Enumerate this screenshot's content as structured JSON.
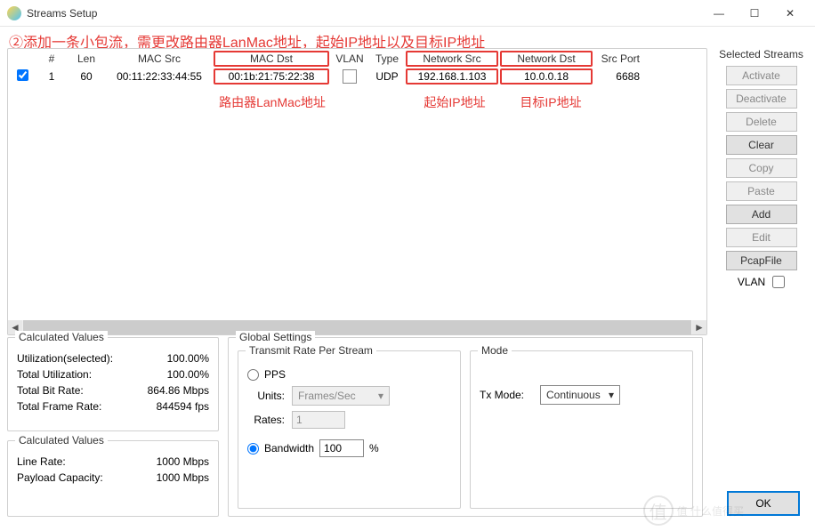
{
  "window": {
    "title": "Streams Setup",
    "minimize": "—",
    "maximize": "☐",
    "close": "✕"
  },
  "top_annotation": "②添加一条小包流，需更改路由器LanMac地址，起始IP地址以及目标IP地址",
  "table": {
    "headers": {
      "num": "#",
      "len": "Len",
      "mac_src": "MAC Src",
      "mac_dst": "MAC Dst",
      "vlan": "VLAN",
      "type": "Type",
      "net_src": "Network Src",
      "net_dst": "Network Dst",
      "src_port": "Src Port"
    },
    "row": {
      "checked": true,
      "num": "1",
      "len": "60",
      "mac_src": "00:11:22:33:44:55",
      "mac_dst": "00:1b:21:75:22:38",
      "vlan": "",
      "type": "UDP",
      "net_src": "192.168.1.103",
      "net_dst": "10.0.0.18",
      "src_port": "6688"
    }
  },
  "annotations": {
    "mac_dst": "路由器LanMac地址",
    "net_src": "起始IP地址",
    "net_dst": "目标IP地址"
  },
  "sidebar": {
    "title": "Selected Streams",
    "activate": "Activate",
    "deactivate": "Deactivate",
    "delete": "Delete",
    "clear": "Clear",
    "copy": "Copy",
    "paste": "Paste",
    "add": "Add",
    "edit": "Edit",
    "pcap": "PcapFile",
    "vlan_label": "VLAN"
  },
  "calc1": {
    "legend": "Calculated Values",
    "util_sel_k": "Utilization(selected):",
    "util_sel_v": "100.00%",
    "total_util_k": "Total Utilization:",
    "total_util_v": "100.00%",
    "bitrate_k": "Total Bit Rate:",
    "bitrate_v": "864.86 Mbps",
    "framerate_k": "Total Frame Rate:",
    "framerate_v": "844594 fps"
  },
  "calc2": {
    "legend": "Calculated Values",
    "linerate_k": "Line Rate:",
    "linerate_v": "1000 Mbps",
    "payload_k": "Payload Capacity:",
    "payload_v": "1000 Mbps"
  },
  "gs": {
    "legend": "Global Settings",
    "tx_legend": "Transmit Rate Per Stream",
    "mode_legend": "Mode",
    "pps_label": "PPS",
    "units_label": "Units:",
    "units_value": "Frames/Sec",
    "rates_label": "Rates:",
    "rates_value": "1",
    "bw_label": "Bandwidth",
    "bw_value": "100",
    "bw_pct": "%",
    "txmode_label": "Tx Mode:",
    "txmode_value": "Continuous"
  },
  "ok": "OK",
  "watermark": "值 什么值得买"
}
